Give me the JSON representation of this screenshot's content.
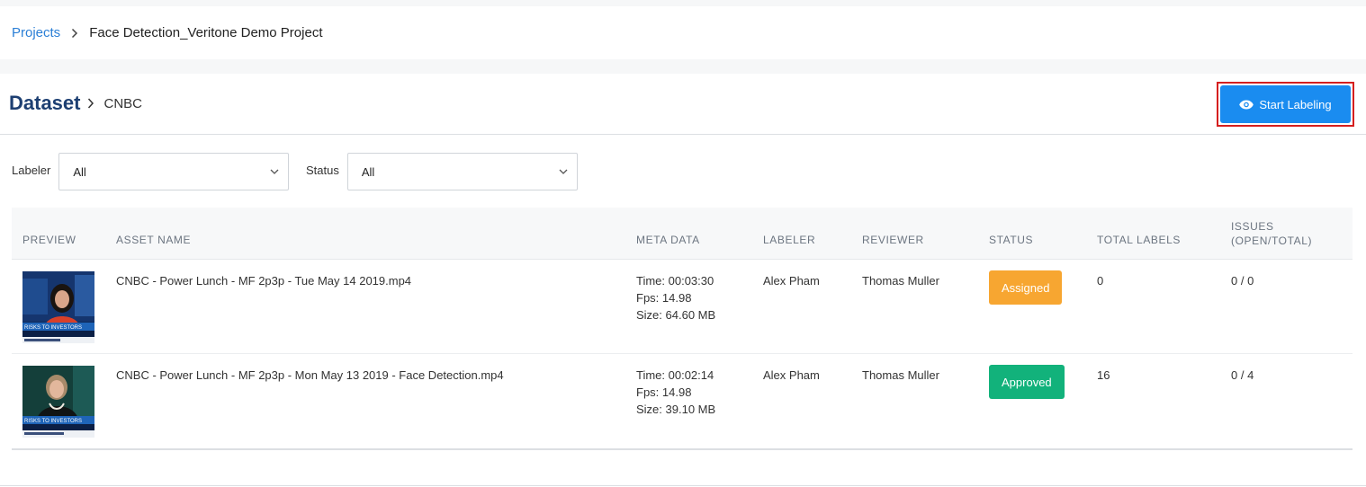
{
  "breadcrumb": {
    "projects": "Projects",
    "current": "Face Detection_Veritone Demo Project"
  },
  "header": {
    "title": "Dataset",
    "subtitle": "CNBC",
    "start_label": "Start Labeling"
  },
  "filters": {
    "labeler_label": "Labeler",
    "labeler_value": "All",
    "status_label": "Status",
    "status_value": "All"
  },
  "table": {
    "headers": {
      "preview": "PREVIEW",
      "asset_name": "ASSET NAME",
      "meta_data": "META DATA",
      "labeler": "LABELER",
      "reviewer": "REVIEWER",
      "status": "STATUS",
      "total_labels": "TOTAL LABELS",
      "issues_1": "ISSUES",
      "issues_2": "(OPEN/TOTAL)"
    },
    "rows": [
      {
        "asset_name": "CNBC - Power Lunch - MF 2p3p - Tue May 14 2019.mp4",
        "time": "Time: 00:03:30",
        "fps": "Fps: 14.98",
        "size": "Size: 64.60 MB",
        "labeler": "Alex Pham",
        "reviewer": "Thomas Muller",
        "status": "Assigned",
        "total_labels": "0",
        "issues": "0 / 0",
        "thumb_caption": "RISKS TO INVESTORS"
      },
      {
        "asset_name": "CNBC - Power Lunch - MF 2p3p - Mon May 13 2019 - Face Detection.mp4",
        "time": "Time: 00:02:14",
        "fps": "Fps: 14.98",
        "size": "Size: 39.10 MB",
        "labeler": "Alex Pham",
        "reviewer": "Thomas Muller",
        "status": "Approved",
        "total_labels": "16",
        "issues": "0 / 4",
        "thumb_caption": "RISKS TO INVESTORS"
      }
    ]
  },
  "colors": {
    "link": "#2b7fd6",
    "primary": "#1a8cf0",
    "assigned": "#f7a631",
    "approved": "#12b27b",
    "highlight": "#d51f1f"
  }
}
